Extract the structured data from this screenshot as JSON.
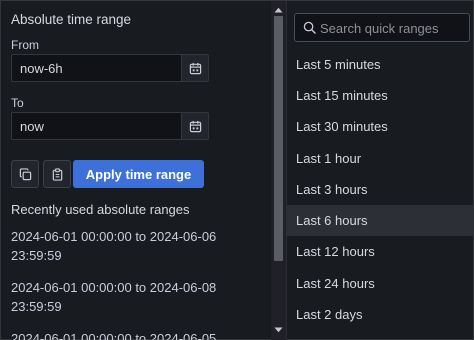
{
  "absolute": {
    "title": "Absolute time range",
    "from_label": "From",
    "from_value": "now-6h",
    "to_label": "To",
    "to_value": "now",
    "apply_label": "Apply time range"
  },
  "recent": {
    "title": "Recently used absolute ranges",
    "items": [
      {
        "line1": "2024-06-01 00:00:00 to 2024-06-06",
        "line2": "23:59:59"
      },
      {
        "line1": "2024-06-01 00:00:00 to 2024-06-08",
        "line2": "23:59:59"
      },
      {
        "line1": "2024-06-01 00:00:00 to 2024-06-05",
        "line2": ""
      }
    ]
  },
  "quick": {
    "search_placeholder": "Search quick ranges",
    "selected": "Last 6 hours",
    "items": [
      "Last 5 minutes",
      "Last 15 minutes",
      "Last 30 minutes",
      "Last 1 hour",
      "Last 3 hours",
      "Last 6 hours",
      "Last 12 hours",
      "Last 24 hours",
      "Last 2 days"
    ]
  },
  "colors": {
    "background": "#181b1f",
    "primary_button": "#3d71d9",
    "selected_row": "#2c2f36"
  }
}
